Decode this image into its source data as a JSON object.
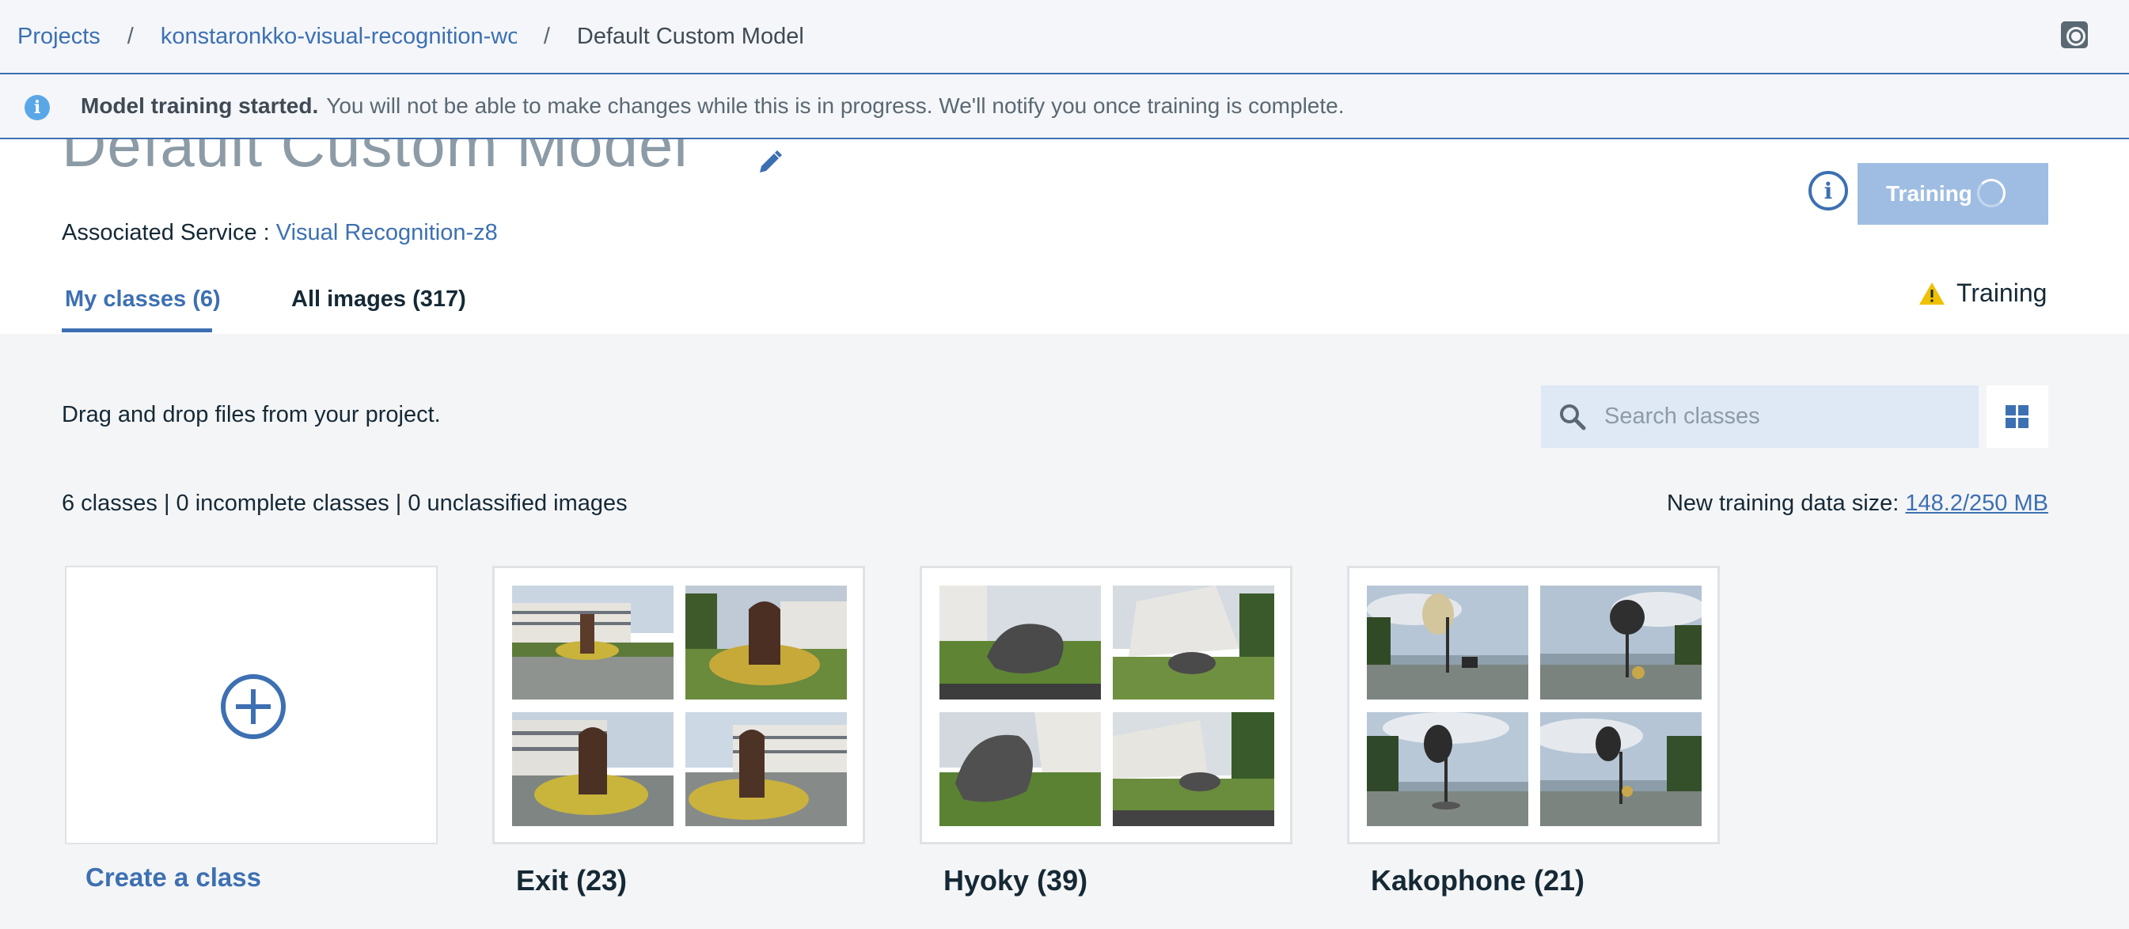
{
  "breadcrumb": {
    "root": "Projects",
    "project": "konstaronkko-visual-recognition-wo",
    "current": "Default Custom Model",
    "separator": "/"
  },
  "banner": {
    "title": "Model training started.",
    "message": "You will not be able to make changes while this is in progress. We'll notify you once training is complete."
  },
  "model": {
    "title": "Default Custom Model",
    "associated_label": "Associated Service : ",
    "associated_service": "Visual Recognition-z8",
    "train_button": "Training",
    "status": "Training"
  },
  "tabs": [
    {
      "label": "My classes (6)",
      "active": true
    },
    {
      "label": "All images (317)",
      "active": false
    }
  ],
  "toolbar": {
    "drag_text": "Drag and drop files from your project.",
    "search_placeholder": "Search classes"
  },
  "summary": {
    "counts": "6 classes | 0 incomplete classes | 0 unclassified images",
    "datasize_label": "New training data size: ",
    "datasize_value": "148.2/250 MB"
  },
  "create_class_label": "Create a class",
  "classes": [
    {
      "label": "Exit (23)",
      "thumbs": [
        "building-sculpture",
        "sculpture-flowers",
        "sculpture-flowers",
        "building-sculpture"
      ]
    },
    {
      "label": "Hyoky (39)",
      "thumbs": [
        "wreck-sculpture",
        "building-lawn",
        "wreck-sculpture",
        "building-lawn"
      ]
    },
    {
      "label": "Kakophone (21)",
      "thumbs": [
        "horn-lakeside",
        "horn-lakeside",
        "horn-lakeside",
        "horn-lakeside"
      ]
    }
  ],
  "colors": {
    "accent": "#3d70b2",
    "train_button": "#9fbde2",
    "warning": "#efc100",
    "info": "#5aa7e8"
  },
  "icons": [
    "settings-icon",
    "info-icon",
    "edit-icon",
    "spinner-icon",
    "warning-icon",
    "search-icon",
    "grid-view-icon",
    "add-circle-icon"
  ]
}
